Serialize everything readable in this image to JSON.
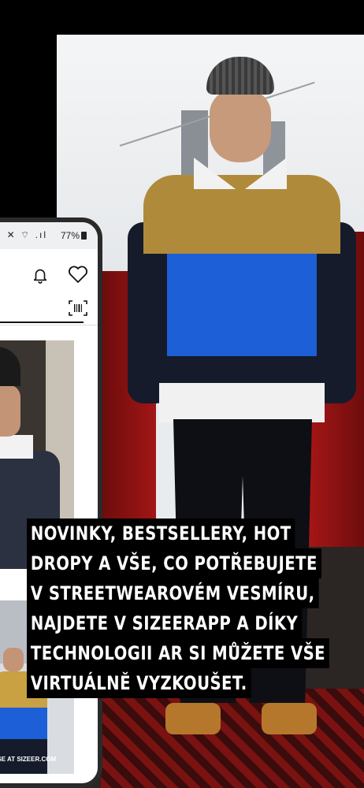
{
  "phone": {
    "status": {
      "time_hidden": "",
      "icons": "✕ ⌔ .ıl",
      "battery": "77%"
    },
    "header": {
      "bell_icon": "bell-icon",
      "heart_icon": "heart-icon",
      "barcode_icon": "barcode-icon"
    },
    "products": [
      {
        "image": "model-denim-jacket"
      },
      {
        "image": "model-colorblock-sweatshirt",
        "banner": "VERSE AT SIZEER.COM"
      }
    ]
  },
  "hero": {
    "image": "model-colorblock-sweatshirt-street"
  },
  "headline": {
    "lines": [
      "NOVINKY, BESTSELLERY, HOT",
      "DROPY A VŠE, CO POTŘEBUJETE",
      "V STREETWEAROVÉM VESMÍRU,",
      "NAJDETE V SIZEERAPP A DÍKY",
      "TECHNOLOGII AR SI MŮŽETE VŠE",
      "VIRTUÁLNĚ VYZKOUŠET."
    ]
  },
  "colors": {
    "background": "#000000",
    "highlight_text": "#ffffff",
    "accent_blue": "#1d5fd6",
    "accent_mustard": "#b08a3b"
  }
}
